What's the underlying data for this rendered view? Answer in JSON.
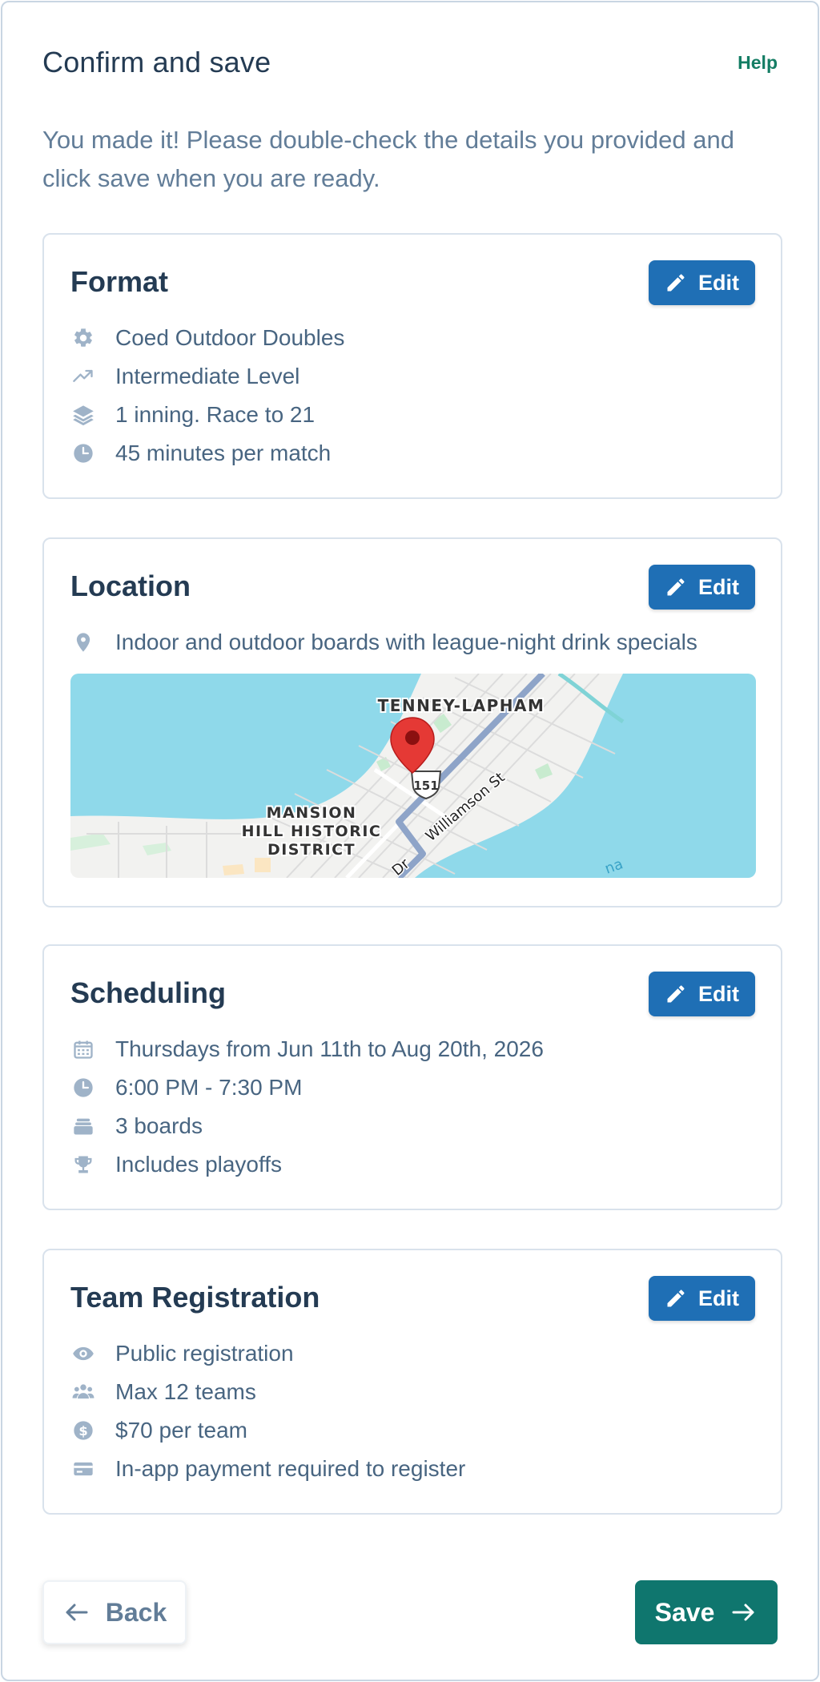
{
  "header": {
    "title": "Confirm and save",
    "help_label": "Help"
  },
  "intro": "You made it! Please double-check the details you provided and click save when you are ready.",
  "edit_label": "Edit",
  "format": {
    "title": "Format",
    "items": [
      {
        "icon": "gear-icon",
        "text": "Coed Outdoor Doubles"
      },
      {
        "icon": "trending-up-icon",
        "text": "Intermediate Level"
      },
      {
        "icon": "layers-icon",
        "text": "1 inning. Race to 21"
      },
      {
        "icon": "clock-icon",
        "text": "45 minutes per match"
      }
    ]
  },
  "location": {
    "title": "Location",
    "items": [
      {
        "icon": "map-pin-icon",
        "text": "Indoor and outdoor boards with league-night drink specials"
      }
    ],
    "map": {
      "labels": {
        "neighborhood_1": "TENNEY-LAPHAM",
        "neighborhood_2_line1": "MANSION",
        "neighborhood_2_line2": "HILL HISTORIC",
        "neighborhood_2_line3": "DISTRICT",
        "street": "Williamson St",
        "highway": "151",
        "road_fragment": "Dr",
        "water_fragment": "na"
      }
    }
  },
  "scheduling": {
    "title": "Scheduling",
    "items": [
      {
        "icon": "calendar-icon",
        "text": "Thursdays from Jun 11th to Aug 20th, 2026"
      },
      {
        "icon": "clock-icon",
        "text": "6:00 PM - 7:30 PM"
      },
      {
        "icon": "boards-icon",
        "text": "3 boards"
      },
      {
        "icon": "trophy-icon",
        "text": "Includes playoffs"
      }
    ]
  },
  "registration": {
    "title": "Team Registration",
    "items": [
      {
        "icon": "eye-icon",
        "text": "Public registration"
      },
      {
        "icon": "users-icon",
        "text": "Max 12 teams"
      },
      {
        "icon": "dollar-icon",
        "text": "$70 per team"
      },
      {
        "icon": "credit-card-icon",
        "text": "In-app payment required to register"
      }
    ]
  },
  "footer": {
    "back_label": "Back",
    "save_label": "Save"
  },
  "colors": {
    "primary": "#1f6fb5",
    "save": "#0f766e",
    "help": "#147d64",
    "icon": "#9fb3c8",
    "water": "#8fd9ea",
    "pin": "#e53935"
  }
}
